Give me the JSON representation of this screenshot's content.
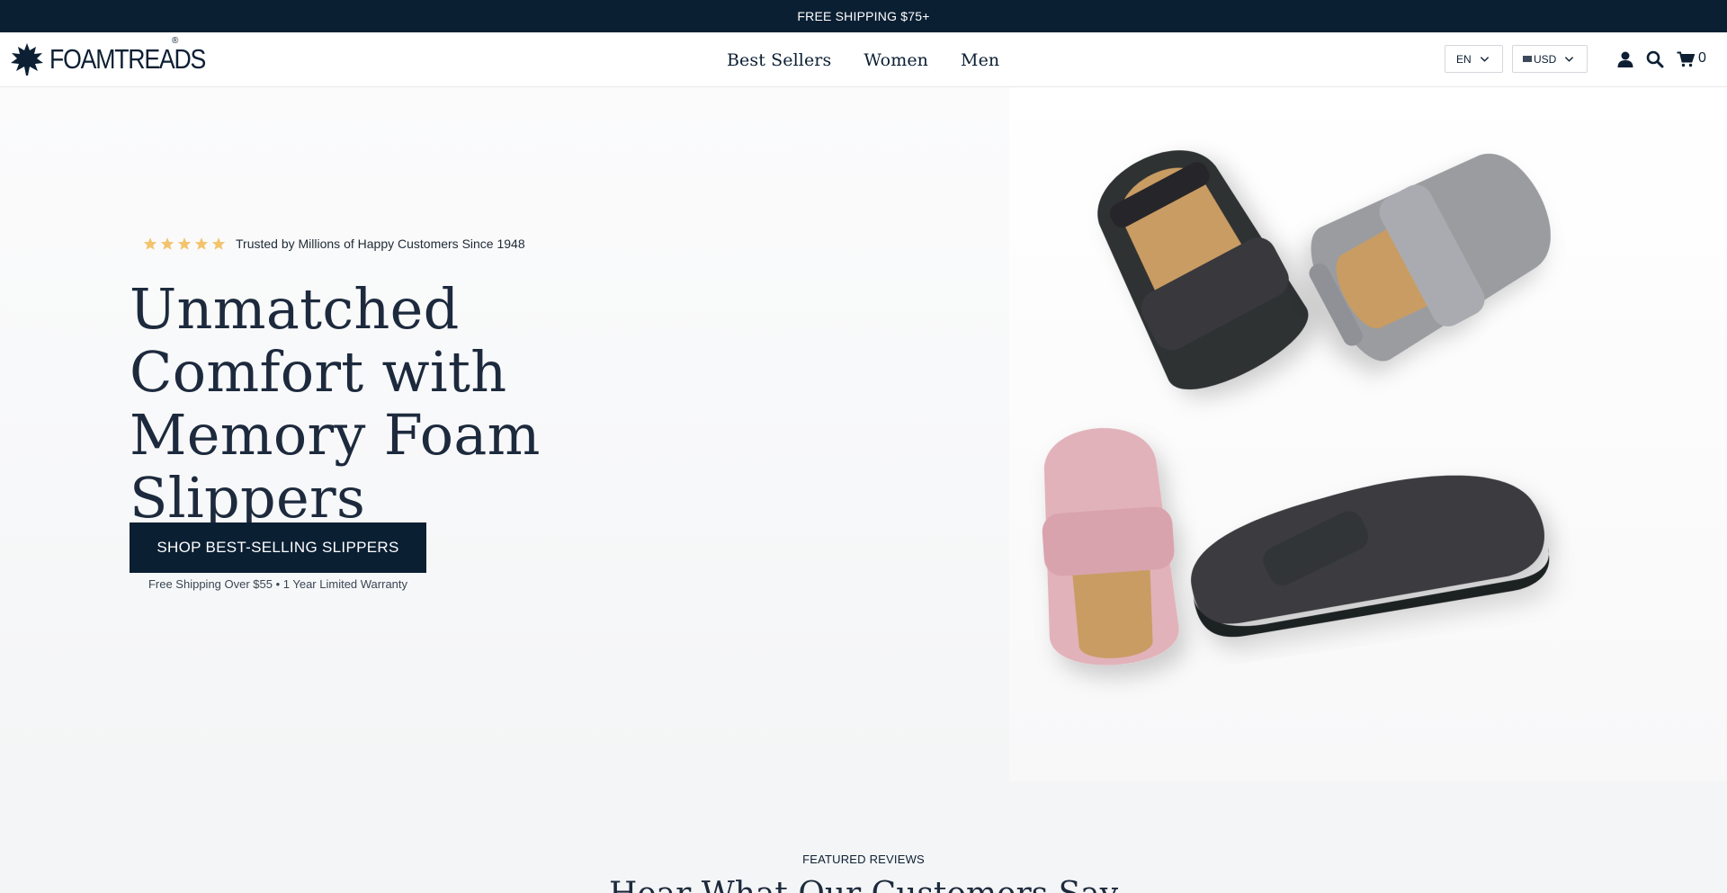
{
  "announcement": {
    "text": "FREE SHIPPING $75+"
  },
  "header": {
    "logo_text": "FOAMTREADS",
    "logo_reg": "®",
    "nav": [
      {
        "label": "Best Sellers"
      },
      {
        "label": "Women"
      },
      {
        "label": "Men"
      }
    ],
    "language": {
      "selected": "EN"
    },
    "currency": {
      "selected": "USD"
    },
    "cart_count": "0",
    "icons": [
      "account-icon",
      "search-icon",
      "cart-icon"
    ]
  },
  "hero": {
    "rating_stars": 5,
    "trust_text": "Trusted by Millions of Happy Customers Since 1948",
    "headline": "Unmatched Comfort with Memory Foam Slippers",
    "cta_label": "SHOP BEST-SELLING SLIPPERS",
    "cta_subtext": "Free Shipping Over $55 • 1 Year Limited Warranty"
  },
  "reviews": {
    "label": "FEATURED REVIEWS",
    "title": "Hear What Our Customers Say"
  },
  "colors": {
    "brand_navy": "#0b1f33",
    "headline": "#1d2a3d",
    "star": "#f2c46d",
    "slipper_black": "#2f3033",
    "slipper_grey": "#9a9ca0",
    "slipper_pink": "#e2b2ba",
    "insole_tan": "#c99c63"
  }
}
